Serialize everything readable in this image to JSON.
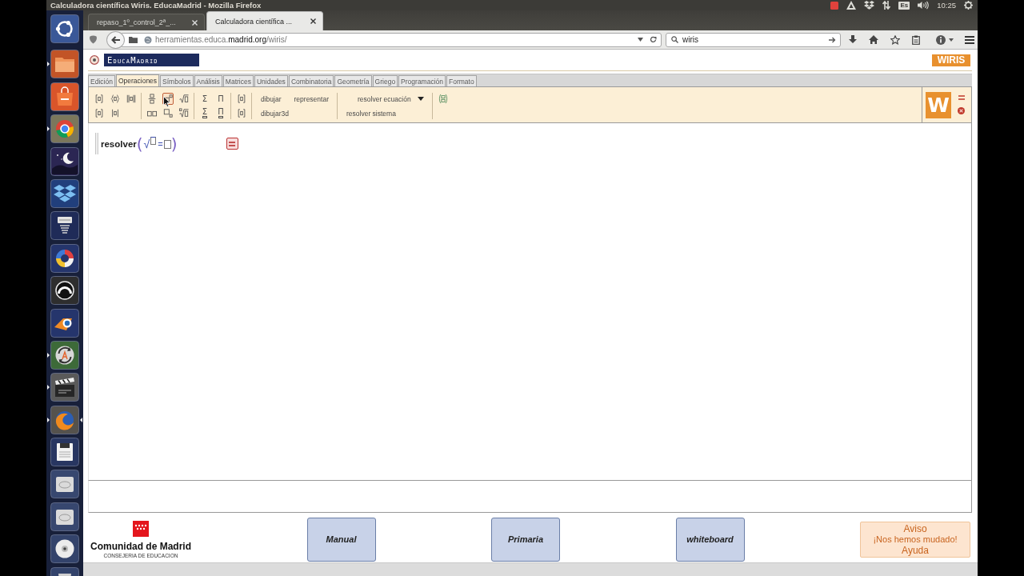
{
  "panel": {
    "title": "Calculadora científica Wiris. EducaMadrid - Mozilla Firefox",
    "indicators": [
      {
        "kind": "record"
      },
      {
        "kind": "triangle"
      },
      {
        "kind": "box"
      },
      {
        "kind": "network"
      },
      {
        "kind": "keyboard",
        "label": "Es"
      },
      {
        "kind": "volume"
      },
      {
        "kind": "clock",
        "label": "10:25"
      },
      {
        "kind": "gear"
      }
    ]
  },
  "launcher": [
    {
      "kind": "dash",
      "running": false,
      "focused": false
    },
    {
      "kind": "folder",
      "running": true,
      "focused": false
    },
    {
      "kind": "bag",
      "running": false,
      "focused": false
    },
    {
      "kind": "ring",
      "running": true,
      "focused": false
    },
    {
      "kind": "night",
      "running": false,
      "focused": false
    },
    {
      "kind": "box",
      "running": false,
      "focused": false
    },
    {
      "kind": "lamp",
      "running": false,
      "focused": false
    },
    {
      "kind": "pinwheel",
      "running": false,
      "focused": false
    },
    {
      "kind": "wave",
      "running": false,
      "focused": false
    },
    {
      "kind": "eye",
      "running": false,
      "focused": false
    },
    {
      "kind": "update",
      "running": true,
      "focused": false
    },
    {
      "kind": "clapper",
      "running": true,
      "focused": false
    },
    {
      "kind": "fox",
      "running": true,
      "focused": true
    },
    {
      "kind": "floppy",
      "running": false,
      "focused": false
    },
    {
      "kind": "drive",
      "running": false,
      "focused": false
    },
    {
      "kind": "drive",
      "running": false,
      "focused": false
    },
    {
      "kind": "disc",
      "running": false,
      "focused": false
    },
    {
      "kind": "trash",
      "running": false,
      "focused": false
    }
  ],
  "browser": {
    "tabs": [
      {
        "label": "repaso_1º_control_2ª_...",
        "selected": false
      },
      {
        "label": "Calculadora científica ...",
        "selected": true
      }
    ],
    "url": {
      "prefix": "herramientas.educa.",
      "domain": "madrid.org",
      "path": "/wiris/"
    },
    "search": {
      "value": "wiris"
    }
  },
  "wiris": {
    "logo": "EducaMadrid",
    "brand": "WIRIS",
    "menu_tabs": [
      {
        "label": "Edición",
        "selected": false
      },
      {
        "label": "Operaciones",
        "selected": true
      },
      {
        "label": "Símbolos",
        "selected": false
      },
      {
        "label": "Análisis",
        "selected": false
      },
      {
        "label": "Matrices",
        "selected": false
      },
      {
        "label": "Unidades",
        "selected": false
      },
      {
        "label": "Combinatoria",
        "selected": false
      },
      {
        "label": "Geometría",
        "selected": false
      },
      {
        "label": "Griego",
        "selected": false
      },
      {
        "label": "Programación",
        "selected": false
      },
      {
        "label": "Formato",
        "selected": false
      }
    ],
    "toolbar": {
      "groups": [
        {
          "rows": [
            [
              {
                "kind": "brackets",
                "hovered": false
              },
              {
                "kind": "braces",
                "hovered": false
              },
              {
                "kind": "abs",
                "hovered": false
              }
            ],
            [
              {
                "kind": "brackets",
                "hovered": false
              },
              {
                "kind": "bars",
                "hovered": false
              }
            ]
          ]
        },
        {
          "rows": [
            [
              {
                "kind": "fraction",
                "hovered": false
              },
              {
                "kind": "power",
                "hovered": true
              },
              {
                "kind": "sqrt",
                "hovered": false
              }
            ],
            [
              {
                "kind": "juxtapose",
                "hovered": false
              },
              {
                "kind": "subscript",
                "hovered": false
              },
              {
                "kind": "root",
                "hovered": false
              }
            ]
          ]
        },
        {
          "rows": [
            [
              {
                "kind": "sum",
                "symbol": "Σ",
                "hovered": false
              },
              {
                "kind": "product",
                "symbol": "Π",
                "hovered": false
              }
            ],
            [
              {
                "kind": "sum_limits",
                "symbol": "Σ",
                "hovered": false
              },
              {
                "kind": "product_limits",
                "symbol": "Π",
                "hovered": false
              }
            ]
          ]
        },
        {
          "rows": [
            [
              {
                "kind": "brackets",
                "hovered": false
              }
            ],
            [
              {
                "kind": "brackets",
                "hovered": false
              }
            ]
          ]
        },
        {
          "rows": [
            [
              {
                "kind": "command",
                "label": "dibujar",
                "hovered": false
              },
              {
                "kind": "command",
                "label": "representar",
                "hovered": false
              }
            ],
            [
              {
                "kind": "command",
                "label": "dibujar3d",
                "hovered": false
              }
            ]
          ]
        },
        {
          "rows": [
            [
              {
                "kind": "menu",
                "label": "resolver ecuación",
                "hovered": false
              }
            ],
            [
              {
                "kind": "command",
                "label": "resolver sistema",
                "hovered": false
              }
            ]
          ]
        },
        {
          "rows": [
            [
              {
                "kind": "curly",
                "hovered": false
              }
            ]
          ]
        }
      ]
    },
    "brand_mark": "W",
    "expression": {
      "function": "resolver",
      "open": "(",
      "radical": "√",
      "operator": "=",
      "close": ")"
    }
  },
  "footer": {
    "organization": "Comunidad de Madrid",
    "department": "CONSEJERIA DE EDUCACION",
    "links": [
      "Manual",
      "Primaria",
      "whiteboard"
    ],
    "notice": {
      "title": "Aviso",
      "message": "¡Nos hemos mudado!",
      "link": "Ayuda"
    }
  }
}
